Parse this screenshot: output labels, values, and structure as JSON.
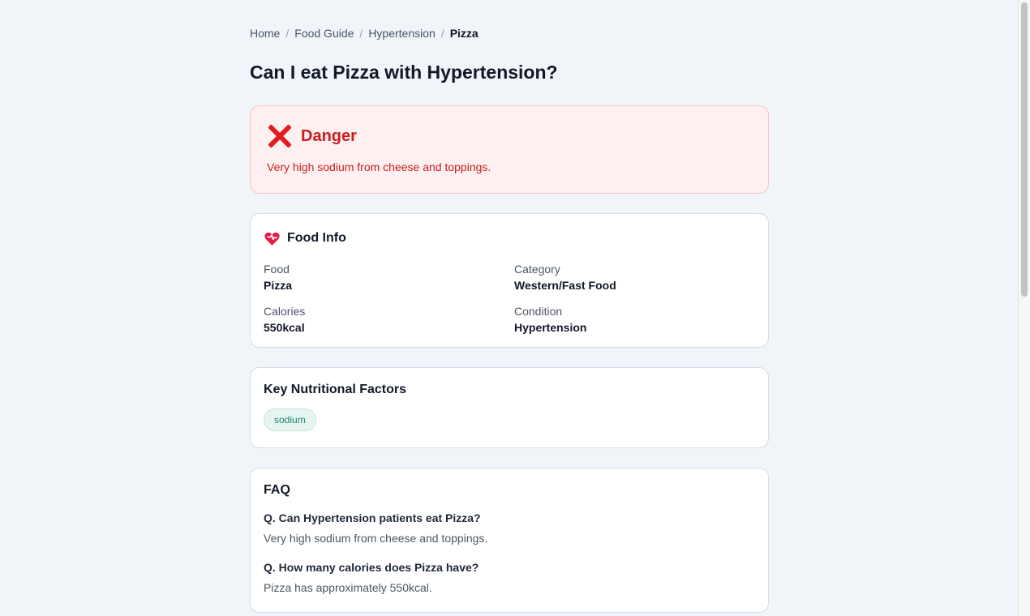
{
  "breadcrumb": {
    "items": [
      "Home",
      "Food Guide",
      "Hypertension"
    ],
    "current": "Pizza",
    "separator": "/"
  },
  "page_title": "Can I eat Pizza with Hypertension?",
  "verdict": {
    "icon": "cross-mark-icon",
    "title": "Danger",
    "description": "Very high sodium from cheese and toppings.",
    "color": "#c81e1e"
  },
  "food_info": {
    "icon": "heart-icon",
    "title": "Food Info",
    "fields": [
      {
        "label": "Food",
        "value": "Pizza"
      },
      {
        "label": "Category",
        "value": "Western/Fast Food"
      },
      {
        "label": "Calories",
        "value": "550kcal"
      },
      {
        "label": "Condition",
        "value": "Hypertension"
      }
    ]
  },
  "key_factors": {
    "title": "Key Nutritional Factors",
    "tags": [
      "sodium"
    ]
  },
  "faq": {
    "title": "FAQ",
    "items": [
      {
        "q": "Q. Can Hypertension patients eat Pizza?",
        "a": "Very high sodium from cheese and toppings."
      },
      {
        "q": "Q. How many calories does Pizza have?",
        "a": "Pizza has approximately 550kcal."
      }
    ]
  }
}
